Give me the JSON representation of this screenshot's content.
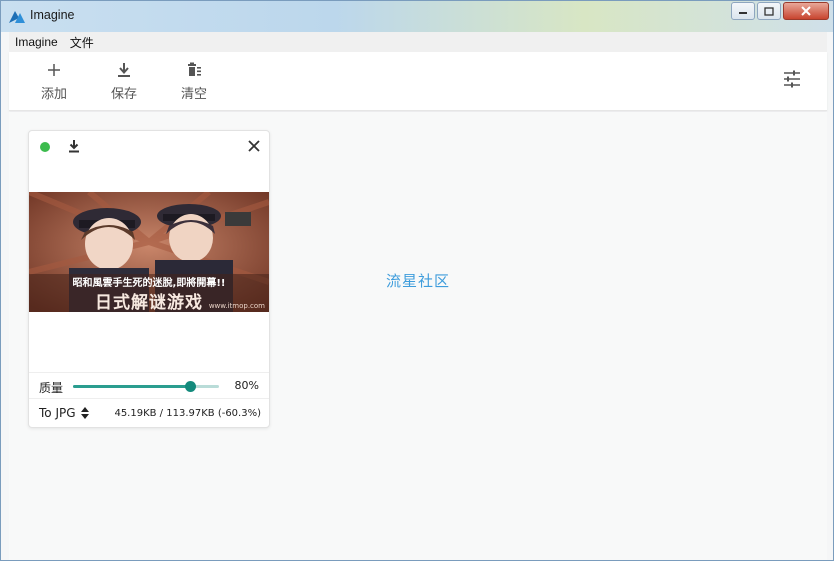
{
  "window": {
    "title": "Imagine"
  },
  "menubar": {
    "items": [
      "Imagine",
      "文件"
    ]
  },
  "toolbar": {
    "add_label": "添加",
    "save_label": "保存",
    "clear_label": "清空",
    "settings_icon": "settings-sliders-icon"
  },
  "card": {
    "status_color": "#3cbb4d",
    "image_caption_line1": "昭和風雲手生死的迷脫,即將開幕!!",
    "image_caption_line2": "日式解谜游戏",
    "image_url_text": "www.itmop.com",
    "quality_label": "质量",
    "quality_value": 0.8,
    "quality_text": "80%",
    "format_label": "To JPG",
    "size_info": "45.19KB / 113.97KB (-60.3%)"
  },
  "watermark": "流星社区",
  "colors": {
    "accent": "#138a7c",
    "link_blue": "#3f9ddc"
  }
}
